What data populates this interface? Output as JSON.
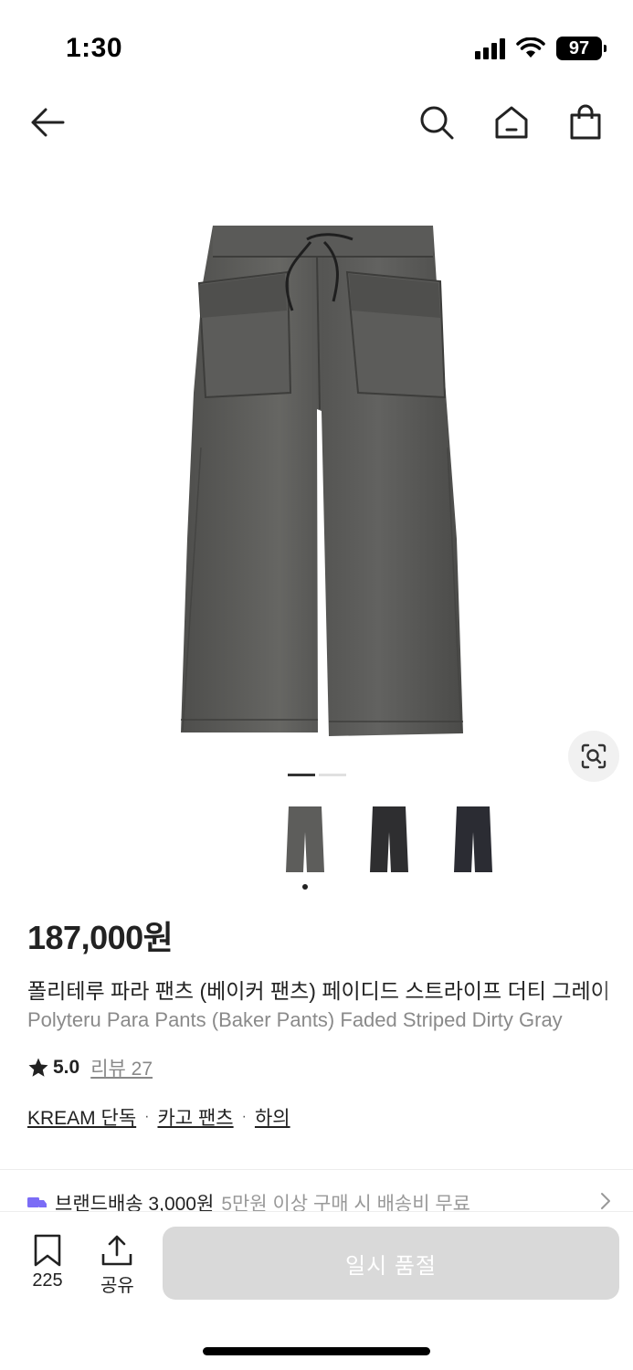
{
  "status": {
    "time": "1:30",
    "battery": "97"
  },
  "product": {
    "price": "187,000원",
    "title_ko": "폴리테루 파라 팬츠 (베이커 팬츠) 페이디드 스트라이프 더티 그레이",
    "title_en": "Polyteru Para Pants (Baker Pants) Faded Striped Dirty Gray",
    "rating": "5.0",
    "review_label": "리뷰 27",
    "categories": [
      "KREAM 단독",
      "카고 팬츠",
      "하의"
    ],
    "main_image_color": "#5b5b59",
    "thumbnail_colors": [
      "#5d5d5b",
      "#2e2e30",
      "#2b2c33"
    ]
  },
  "shipping": {
    "label": "브랜드배송 3,000원",
    "sub": "5만원 이상 구매 시 배송비 무료"
  },
  "bottom_bar": {
    "save_count": "225",
    "share_label": "공유",
    "soldout_label": "일시 품절"
  },
  "icons": [
    "back-arrow-icon",
    "search-icon",
    "home-icon",
    "shopping-bag-icon",
    "lens-search-icon",
    "truck-icon",
    "chevron-right-icon",
    "bookmark-icon",
    "share-icon",
    "star-icon"
  ]
}
